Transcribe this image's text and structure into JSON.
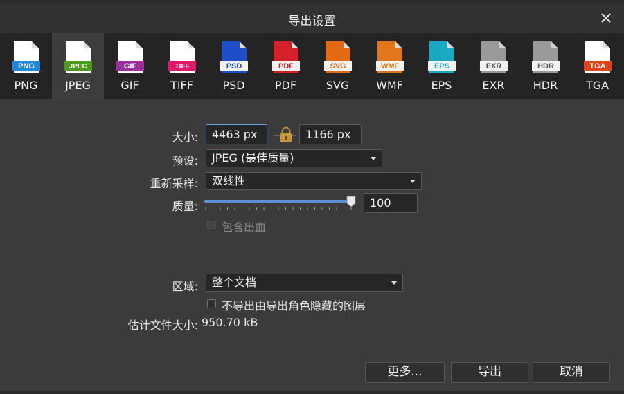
{
  "dialog": {
    "title": "导出设置"
  },
  "formats": [
    {
      "id": "png",
      "label": "PNG",
      "badge": "PNG",
      "color": "#1e8ad6",
      "selected": false
    },
    {
      "id": "jpeg",
      "label": "JPEG",
      "badge": "JPEG",
      "color": "#4d9a1e",
      "selected": true
    },
    {
      "id": "gif",
      "label": "GIF",
      "badge": "GIF",
      "color": "#9c2fa0",
      "selected": false
    },
    {
      "id": "tiff",
      "label": "TIFF",
      "badge": "TIFF",
      "color": "#e0196f",
      "selected": false
    },
    {
      "id": "psd",
      "label": "PSD",
      "badge": "PSD",
      "color": "#1e4fc8",
      "selected": false
    },
    {
      "id": "pdf",
      "label": "PDF",
      "badge": "PDF",
      "color": "#d6202a",
      "selected": false
    },
    {
      "id": "svg",
      "label": "SVG",
      "badge": "SVG",
      "color": "#e26a12",
      "selected": false
    },
    {
      "id": "wmf",
      "label": "WMF",
      "badge": "WMF",
      "color": "#e2761a",
      "selected": false
    },
    {
      "id": "eps",
      "label": "EPS",
      "badge": "EPS",
      "color": "#1aa8c2",
      "selected": false
    },
    {
      "id": "exr",
      "label": "EXR",
      "badge": "EXR",
      "color": "#4a4a4a",
      "selected": false
    },
    {
      "id": "hdr",
      "label": "HDR",
      "badge": "HDR",
      "color": "#5a5a5a",
      "selected": false
    },
    {
      "id": "tga",
      "label": "TGA",
      "badge": "TGA",
      "color": "#e0421a",
      "selected": false
    }
  ],
  "size": {
    "label": "大小:",
    "width": "4463 px",
    "height": "1166 px"
  },
  "preset": {
    "label": "预设:",
    "value": "JPEG (最佳质量)"
  },
  "resample": {
    "label": "重新采样:",
    "value": "双线性"
  },
  "quality": {
    "label": "质量:",
    "value": "100",
    "level": 100
  },
  "bleed": {
    "label": "包含出血",
    "checked": false,
    "disabled": true
  },
  "area": {
    "label": "区域:",
    "value": "整个文档"
  },
  "hidden_layers": {
    "label": "不导出由导出角色隐藏的图层",
    "checked": false
  },
  "file_size": {
    "label": "估计文件大小:",
    "value": "950.70 kB"
  },
  "buttons": {
    "more": "更多...",
    "export": "导出",
    "cancel": "取消"
  },
  "colors": {
    "accent": "#5b8fd6",
    "focus_border": "#6d9ee4"
  }
}
